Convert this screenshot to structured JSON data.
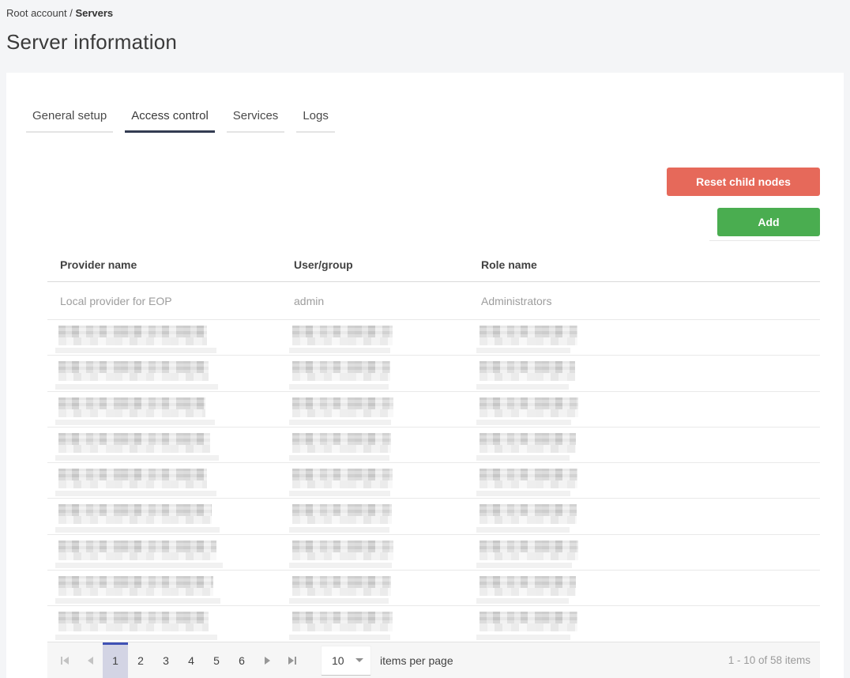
{
  "breadcrumb": {
    "parent": "Root account",
    "separator": " / ",
    "current": "Servers"
  },
  "page": {
    "title": "Server information"
  },
  "tabs": [
    {
      "label": "General setup",
      "active": false
    },
    {
      "label": "Access control",
      "active": true
    },
    {
      "label": "Services",
      "active": false
    },
    {
      "label": "Logs",
      "active": false
    }
  ],
  "toolbar": {
    "reset_label": "Reset child nodes",
    "add_label": "Add"
  },
  "colors": {
    "reset_bg": "#e6695a",
    "add_bg": "#4aad50",
    "active_tab": "#333c52",
    "pager_selected_bg": "#d3d4e4",
    "pager_selected_top": "#3f51b5"
  },
  "table": {
    "columns": [
      "Provider name",
      "User/group",
      "Role name"
    ],
    "rows": [
      {
        "redacted": false,
        "cells": [
          "Local provider for EOP",
          "admin",
          "Administrators"
        ]
      },
      {
        "redacted": true,
        "w": [
          [
            188,
            204
          ],
          [
            127,
            128
          ],
          [
            124,
            119
          ]
        ]
      },
      {
        "redacted": true,
        "w": [
          [
            190,
            206
          ],
          [
            124,
            126
          ],
          [
            121,
            117
          ]
        ]
      },
      {
        "redacted": true,
        "w": [
          [
            186,
            202
          ],
          [
            128,
            129
          ],
          [
            125,
            120
          ]
        ]
      },
      {
        "redacted": true,
        "w": [
          [
            192,
            207
          ],
          [
            125,
            127
          ],
          [
            122,
            118
          ]
        ]
      },
      {
        "redacted": true,
        "w": [
          [
            188,
            204
          ],
          [
            127,
            128
          ],
          [
            124,
            119
          ]
        ]
      },
      {
        "redacted": true,
        "w": [
          [
            194,
            208
          ],
          [
            126,
            127
          ],
          [
            123,
            118
          ]
        ]
      },
      {
        "redacted": true,
        "w": [
          [
            200,
            212
          ],
          [
            128,
            130
          ],
          [
            125,
            121
          ]
        ]
      },
      {
        "redacted": true,
        "w": [
          [
            196,
            209
          ],
          [
            125,
            126
          ],
          [
            122,
            117
          ]
        ]
      },
      {
        "redacted": true,
        "w": [
          [
            190,
            205
          ],
          [
            127,
            128
          ],
          [
            124,
            119
          ]
        ]
      }
    ]
  },
  "pager": {
    "pages": [
      "1",
      "2",
      "3",
      "4",
      "5",
      "6"
    ],
    "current": "1",
    "page_size": "10",
    "items_per_page": "items per page",
    "range": "1 - 10 of 58 items",
    "icons": {
      "first": "first-page",
      "prev": "previous-page",
      "next": "next-page",
      "last": "last-page",
      "caret": "caret-down"
    }
  }
}
